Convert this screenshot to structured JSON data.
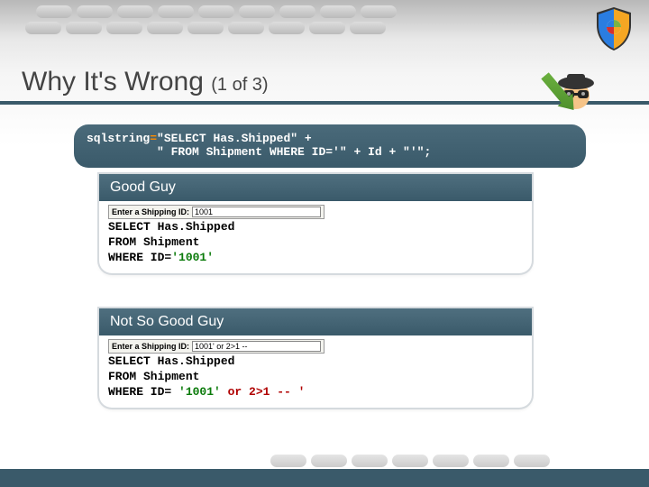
{
  "title_main": "Why It's Wrong ",
  "title_sub": "(1 of 3)",
  "sql_code_line1": "sqlstring",
  "sql_code_eq": "=",
  "sql_code_line1b": "\"SELECT Has.Shipped\" +",
  "sql_code_line2": "          \" FROM Shipment WHERE ID='\" + Id + \"'\";",
  "good": {
    "header": "Good Guy",
    "input_label": "Enter a Shipping ID:",
    "input_value": "1001",
    "sql_l1": "SELECT Has.Shipped",
    "sql_l2": "FROM Shipment",
    "sql_l3a": "WHERE ID=",
    "sql_l3b_green": "'1001'"
  },
  "bad": {
    "header": "Not So Good Guy",
    "input_label": "Enter a Shipping ID:",
    "input_value": "1001' or 2>1 --",
    "sql_l1": "SELECT Has.Shipped",
    "sql_l2": "FROM Shipment",
    "sql_l3a": "WHERE ID= ",
    "sql_l3b_green": "'1001'",
    "sql_l3c_red": " or 2>1 -- '"
  }
}
